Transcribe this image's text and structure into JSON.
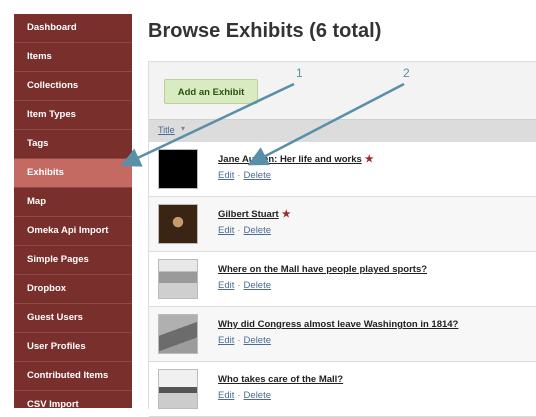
{
  "sidebar": {
    "items": [
      {
        "label": "Dashboard"
      },
      {
        "label": "Items"
      },
      {
        "label": "Collections"
      },
      {
        "label": "Item Types"
      },
      {
        "label": "Tags"
      },
      {
        "label": "Exhibits"
      },
      {
        "label": "Map"
      },
      {
        "label": "Omeka Api Import"
      },
      {
        "label": "Simple Pages"
      },
      {
        "label": "Dropbox"
      },
      {
        "label": "Guest Users"
      },
      {
        "label": "User Profiles"
      },
      {
        "label": "Contributed Items"
      },
      {
        "label": "CSV Import"
      }
    ],
    "active": "Exhibits"
  },
  "header": {
    "title": "Browse Exhibits (6 total)"
  },
  "toolbar": {
    "add_label": "Add an Exhibit"
  },
  "table": {
    "sort_label": "Title",
    "rows": [
      {
        "title": "Jane Austen: Her life and works",
        "featured": true
      },
      {
        "title": "Gilbert Stuart",
        "featured": true
      },
      {
        "title": "Where on the Mall have people played sports?",
        "featured": false
      },
      {
        "title": "Why did Congress almost leave Washington in 1814?",
        "featured": false
      },
      {
        "title": "Who takes care of the Mall?",
        "featured": false
      }
    ],
    "edit_label": "Edit",
    "delete_label": "Delete",
    "separator": "·"
  },
  "annotations": {
    "callout_1": "1",
    "callout_2": "2"
  },
  "colors": {
    "sidebar": "#79302d",
    "active": "#c46a63",
    "star": "#9e2a2a",
    "arrow": "#5a8fa8"
  }
}
